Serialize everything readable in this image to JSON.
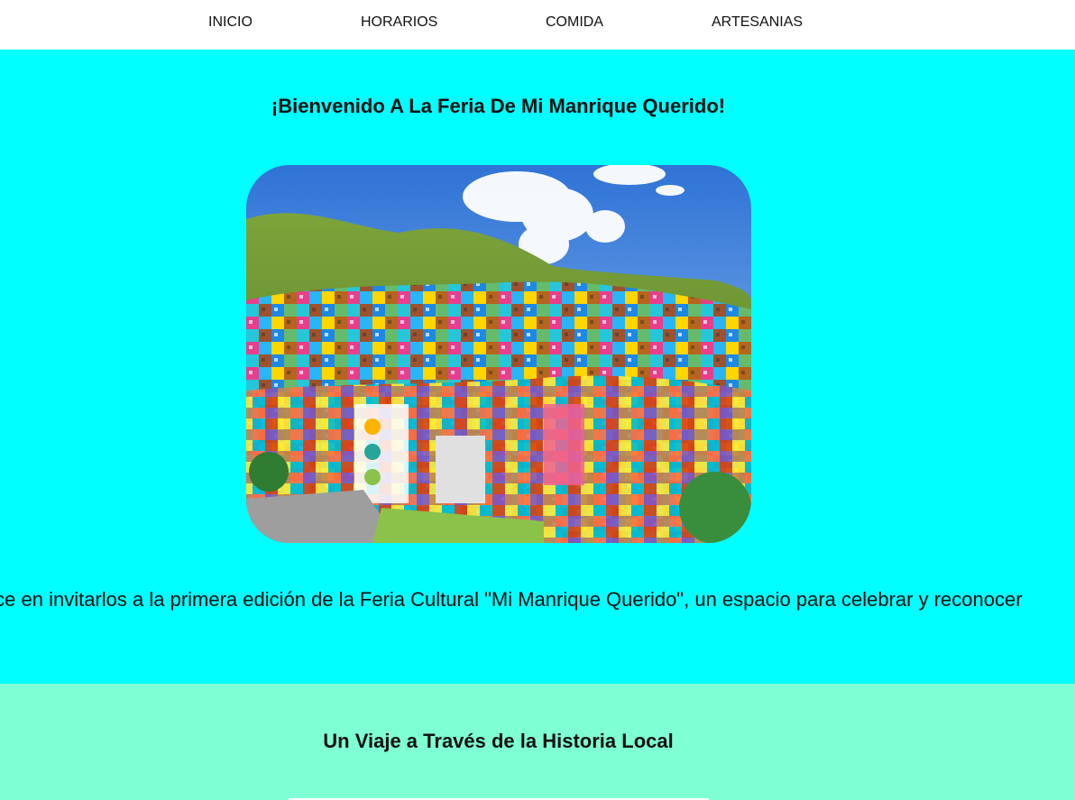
{
  "nav": {
    "items": [
      {
        "label": "INICIO"
      },
      {
        "label": "HORARIOS"
      },
      {
        "label": "COMIDA"
      },
      {
        "label": "ARTESANIAS"
      }
    ]
  },
  "hero": {
    "title": "¡Bienvenido A La Feria De Mi Manrique Querido!",
    "marquee": "Nos complace en invitarlos a la primera edición de la Feria Cultural \"Mi Manrique Querido\", un espacio para celebrar y reconocer"
  },
  "history": {
    "title": "Un Viaje a Través de la Historia Local"
  },
  "colors": {
    "hero_bg": "#00ffff",
    "history_bg": "#7fffd4",
    "nav_bg": "#ffffff"
  }
}
